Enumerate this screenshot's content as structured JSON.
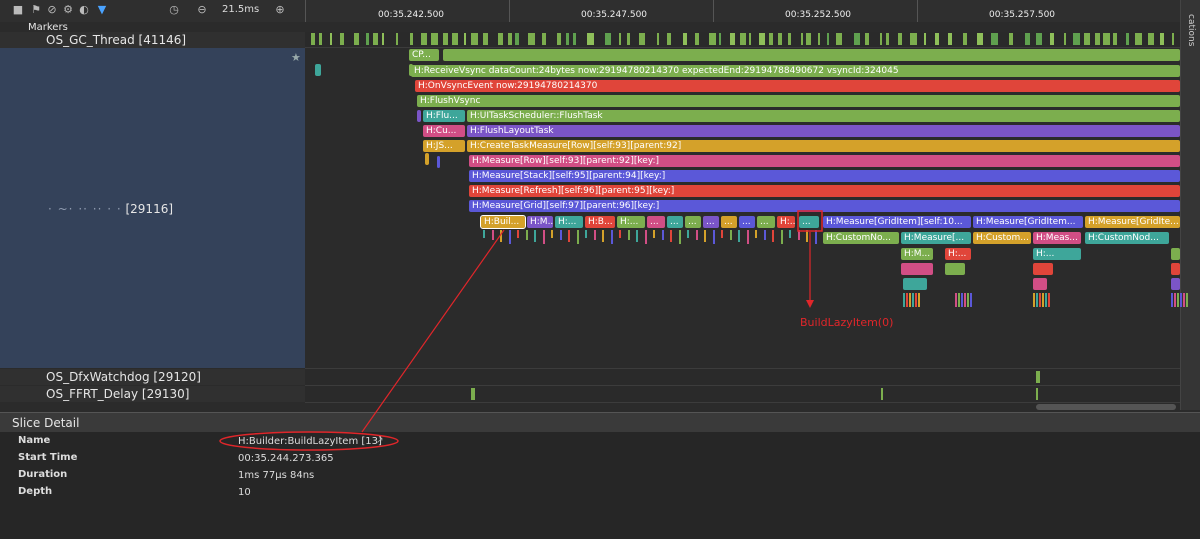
{
  "toolbar": {
    "zoom": "21.5ms"
  },
  "ruler": {
    "ticks": [
      "00:35.242.500",
      "00:35.247.500",
      "00:35.252.500",
      "00:35.257.500"
    ]
  },
  "sidebar": {
    "label": "cations"
  },
  "rows": {
    "markers": "Markers",
    "gc_thread": "OS_GC_Thread [41146]",
    "main_thread": "[29116]",
    "watchdog": "OS_DfxWatchdog [29120]",
    "ffrt": "OS_FFRT_Delay [29130]"
  },
  "slices": {
    "cp": "CP...",
    "receive_vsync": "H:ReceiveVsync dataCount:24bytes now:29194780214370 expectedEnd:29194788490672 vsyncId:324045",
    "on_vsync": "H:OnVsyncEvent now:29194780214370",
    "flush_vsync": "H:FlushVsync",
    "flu": "H:Flu...",
    "flush_task": "H:UITaskScheduler::FlushTask",
    "cu": "H:Cu...",
    "flush_layout": "H:FlushLayoutTask",
    "js": "H:JS...",
    "create_task": "H:CreateTaskMeasure[Row][self:93][parent:92]",
    "measure_row": "H:Measure[Row][self:93][parent:92][key:]",
    "measure_stack": "H:Measure[Stack][self:95][parent:94][key:]",
    "measure_refresh": "H:Measure[Refresh][self:96][parent:95][key:]",
    "measure_grid": "H:Measure[Grid][self:97][parent:96][key:]",
    "buil": "H:Buil...",
    "m1": "H:M...",
    "h1": "H:...",
    "hb": "H:B...",
    "h2": "H:...",
    "dots": "...",
    "h3": "H:...",
    "gi1": "H:Measure[GridItem][self:10...",
    "gi2": "H:Measure[GridItem...",
    "gi3": "H:Measure[GridIte...",
    "cn1": "H:CustomNo...",
    "me1": "H:Measure[...",
    "cu2": "H:Custom...",
    "mea": "H:Meas...",
    "cn2": "H:CustomNod...",
    "hm": "H:M...",
    "hm2": "H:...",
    "hm3": "H:..."
  },
  "annotation": "BuildLazyItem(0)",
  "detail": {
    "title": "Slice Detail",
    "name_label": "Name",
    "name_value": "H:Builder:BuildLazyItem [13]",
    "start_label": "Start Time",
    "start_value": "00:35.244.273.365",
    "duration_label": "Duration",
    "duration_value": "1ms 77μs 84ns",
    "depth_label": "Depth",
    "depth_value": "10"
  },
  "colors": {
    "green": "#7cae4e",
    "red": "#e0453a",
    "pink": "#d14e85",
    "purple": "#7b55c7",
    "blue": "#5b58d8",
    "yellow": "#d4a12a",
    "teal": "#3ea69a",
    "annotation": "#e0262a"
  }
}
